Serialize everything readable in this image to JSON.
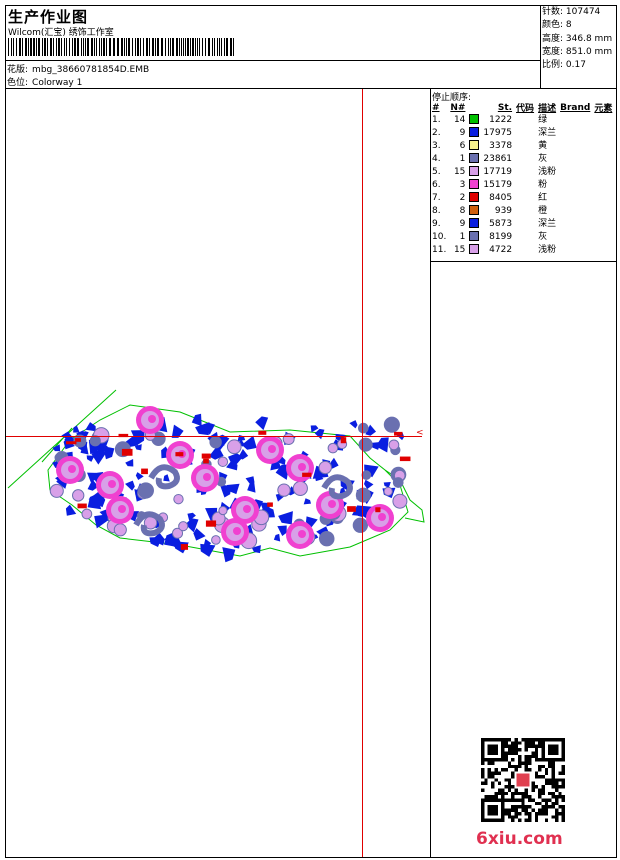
{
  "header": {
    "title": "生产作业图",
    "company": "Wilcom(汇宝) 绣饰工作室",
    "design_label": "花版:",
    "design_file": "mbg_38660781854D.EMB",
    "colorway_label": "色位:",
    "colorway": "Colorway 1"
  },
  "stats": [
    {
      "label": "针数:",
      "value": "107474"
    },
    {
      "label": "颜色:",
      "value": "8"
    },
    {
      "label": "高度:",
      "value": "346.8 mm"
    },
    {
      "label": "宽度:",
      "value": "851.0 mm"
    },
    {
      "label": "比例:",
      "value": "0.17"
    }
  ],
  "sequence": {
    "heading": "停止顺序:",
    "columns": [
      "#",
      "N#",
      "St.",
      "代码",
      "描述",
      "Brand",
      "元素"
    ],
    "rows": [
      {
        "idx": "1.",
        "n": "14",
        "color": "#00c000",
        "st": "1222",
        "desc": "绿"
      },
      {
        "idx": "2.",
        "n": "9",
        "color": "#0a1ee0",
        "st": "17975",
        "desc": "深兰"
      },
      {
        "idx": "3.",
        "n": "6",
        "color": "#f5f08c",
        "st": "3378",
        "desc": "黄"
      },
      {
        "idx": "4.",
        "n": "1",
        "color": "#6a70b0",
        "st": "23861",
        "desc": "灰"
      },
      {
        "idx": "5.",
        "n": "15",
        "color": "#d8a0e8",
        "st": "17719",
        "desc": "浅粉"
      },
      {
        "idx": "6.",
        "n": "3",
        "color": "#f040d0",
        "st": "15179",
        "desc": "粉"
      },
      {
        "idx": "7.",
        "n": "2",
        "color": "#e00000",
        "st": "8405",
        "desc": "红"
      },
      {
        "idx": "8.",
        "n": "8",
        "color": "#d06010",
        "st": "939",
        "desc": "橙"
      },
      {
        "idx": "9.",
        "n": "9",
        "color": "#0a1ee0",
        "st": "5873",
        "desc": "深兰"
      },
      {
        "idx": "10.",
        "n": "1",
        "color": "#6a70b0",
        "st": "8199",
        "desc": "灰"
      },
      {
        "idx": "11.",
        "n": "15",
        "color": "#d8a0e8",
        "st": "4722",
        "desc": "浅粉"
      }
    ]
  },
  "watermark": {
    "site": "6xiu.com"
  }
}
